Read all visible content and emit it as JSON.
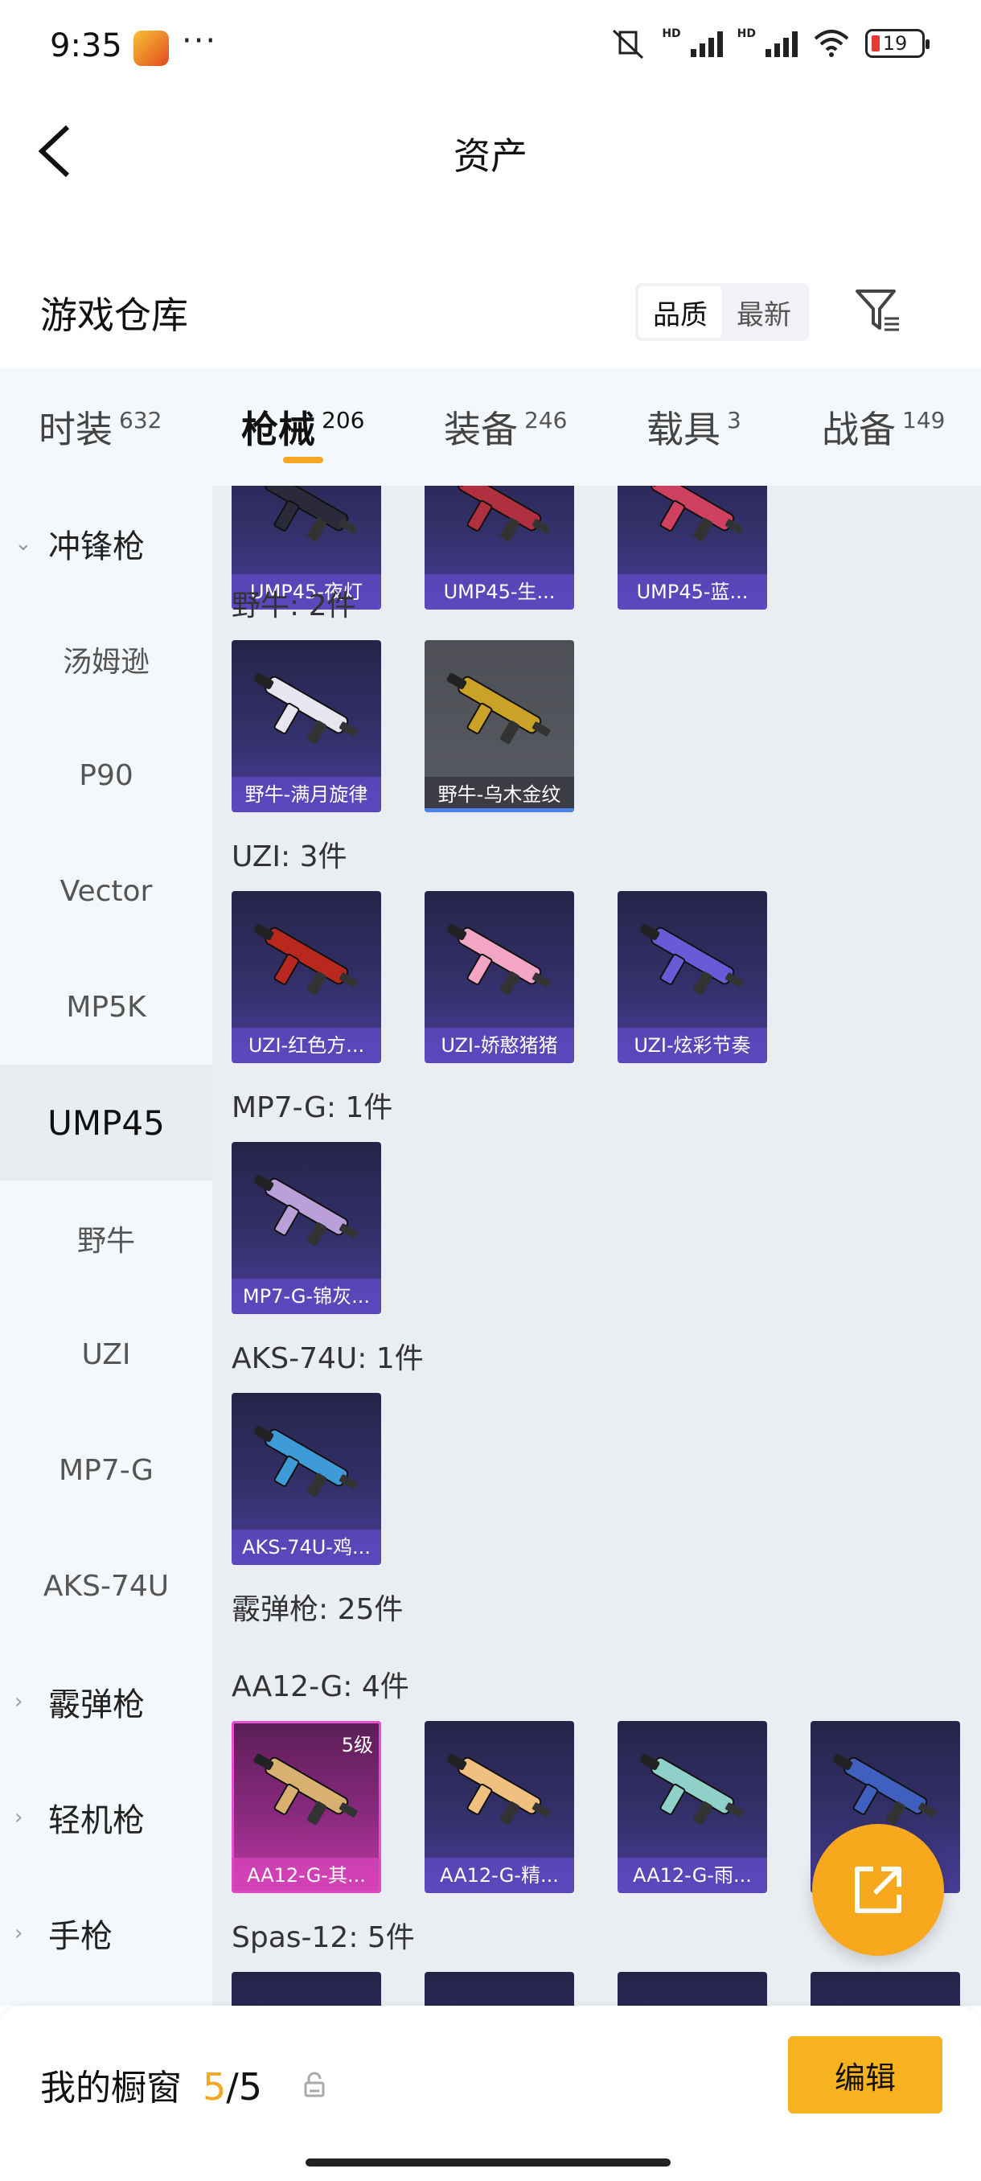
{
  "status": {
    "time": "9:35",
    "more": "···",
    "battery": "19"
  },
  "header": {
    "title": "资产"
  },
  "warehouse": {
    "title": "游戏仓库",
    "sort_options": [
      "品质",
      "最新"
    ]
  },
  "categories": [
    {
      "label": "时装",
      "count": "632"
    },
    {
      "label": "枪械",
      "count": "206"
    },
    {
      "label": "装备",
      "count": "246"
    },
    {
      "label": "载具",
      "count": "3"
    },
    {
      "label": "战备",
      "count": "149"
    }
  ],
  "sidebar": [
    {
      "label": "冲锋枪",
      "type": "group"
    },
    {
      "label": "汤姆逊",
      "type": "sub"
    },
    {
      "label": "P90",
      "type": "sub"
    },
    {
      "label": "Vector",
      "type": "sub"
    },
    {
      "label": "MP5K",
      "type": "sub"
    },
    {
      "label": "UMP45",
      "type": "sub"
    },
    {
      "label": "野牛",
      "type": "sub"
    },
    {
      "label": "UZI",
      "type": "sub"
    },
    {
      "label": "MP7-G",
      "type": "sub"
    },
    {
      "label": "AKS-74U",
      "type": "sub"
    },
    {
      "label": "霰弹枪",
      "type": "group"
    },
    {
      "label": "轻机枪",
      "type": "group"
    },
    {
      "label": "手枪",
      "type": "group"
    }
  ],
  "sections": [
    {
      "title": "",
      "items": [
        {
          "label": "UMP45-夜灯",
          "style": "purple",
          "color": "#2a2a3a"
        },
        {
          "label": "UMP45-生...",
          "style": "purple",
          "color": "#b03040"
        },
        {
          "label": "UMP45-蓝...",
          "style": "purple",
          "color": "#d04060"
        }
      ]
    },
    {
      "title": "野牛: 2件",
      "items": [
        {
          "label": "野牛-满月旋律",
          "style": "purple",
          "color": "#e8e4f0"
        },
        {
          "label": "野牛-乌木金纹",
          "style": "gray",
          "color": "#c9a227"
        }
      ]
    },
    {
      "title": "UZI: 3件",
      "items": [
        {
          "label": "UZI-红色方...",
          "style": "purple",
          "color": "#b8281e"
        },
        {
          "label": "UZI-娇憨猪猪",
          "style": "purple",
          "color": "#f2a6c4"
        },
        {
          "label": "UZI-炫彩节奏",
          "style": "purple",
          "color": "#6a5ad8"
        }
      ]
    },
    {
      "title": "MP7-G: 1件",
      "items": [
        {
          "label": "MP7-G-锦灰...",
          "style": "purple",
          "color": "#b9a0d8"
        }
      ]
    },
    {
      "title": "AKS-74U: 1件",
      "items": [
        {
          "label": "AKS-74U-鸡...",
          "style": "purple",
          "color": "#3f9ad8"
        }
      ]
    },
    {
      "title": "霰弹枪: 25件",
      "items": []
    },
    {
      "title": "AA12-G: 4件",
      "items": [
        {
          "label": "AA12-G-其...",
          "style": "pink",
          "color": "#d8b070",
          "level": "5级"
        },
        {
          "label": "AA12-G-精...",
          "style": "purple",
          "color": "#f0c080"
        },
        {
          "label": "AA12-G-雨...",
          "style": "purple",
          "color": "#8fd0c8"
        },
        {
          "label": "",
          "style": "purple",
          "color": "#4060c0"
        }
      ]
    },
    {
      "title": "Spas-12: 5件",
      "items": [
        {
          "label": "",
          "style": "purple",
          "color": "#c08840"
        },
        {
          "label": "",
          "style": "purple",
          "color": "#c08840"
        },
        {
          "label": "",
          "style": "purple",
          "color": "#c08840"
        },
        {
          "label": "",
          "style": "purple",
          "color": "#c08840"
        }
      ]
    }
  ],
  "bottom": {
    "showcase_label": "我的橱窗",
    "current": "5",
    "separator": "/",
    "total": "5",
    "edit_label": "编辑"
  },
  "colors": {
    "accent": "#f5a623",
    "edit_bg": "#f7b21f"
  }
}
